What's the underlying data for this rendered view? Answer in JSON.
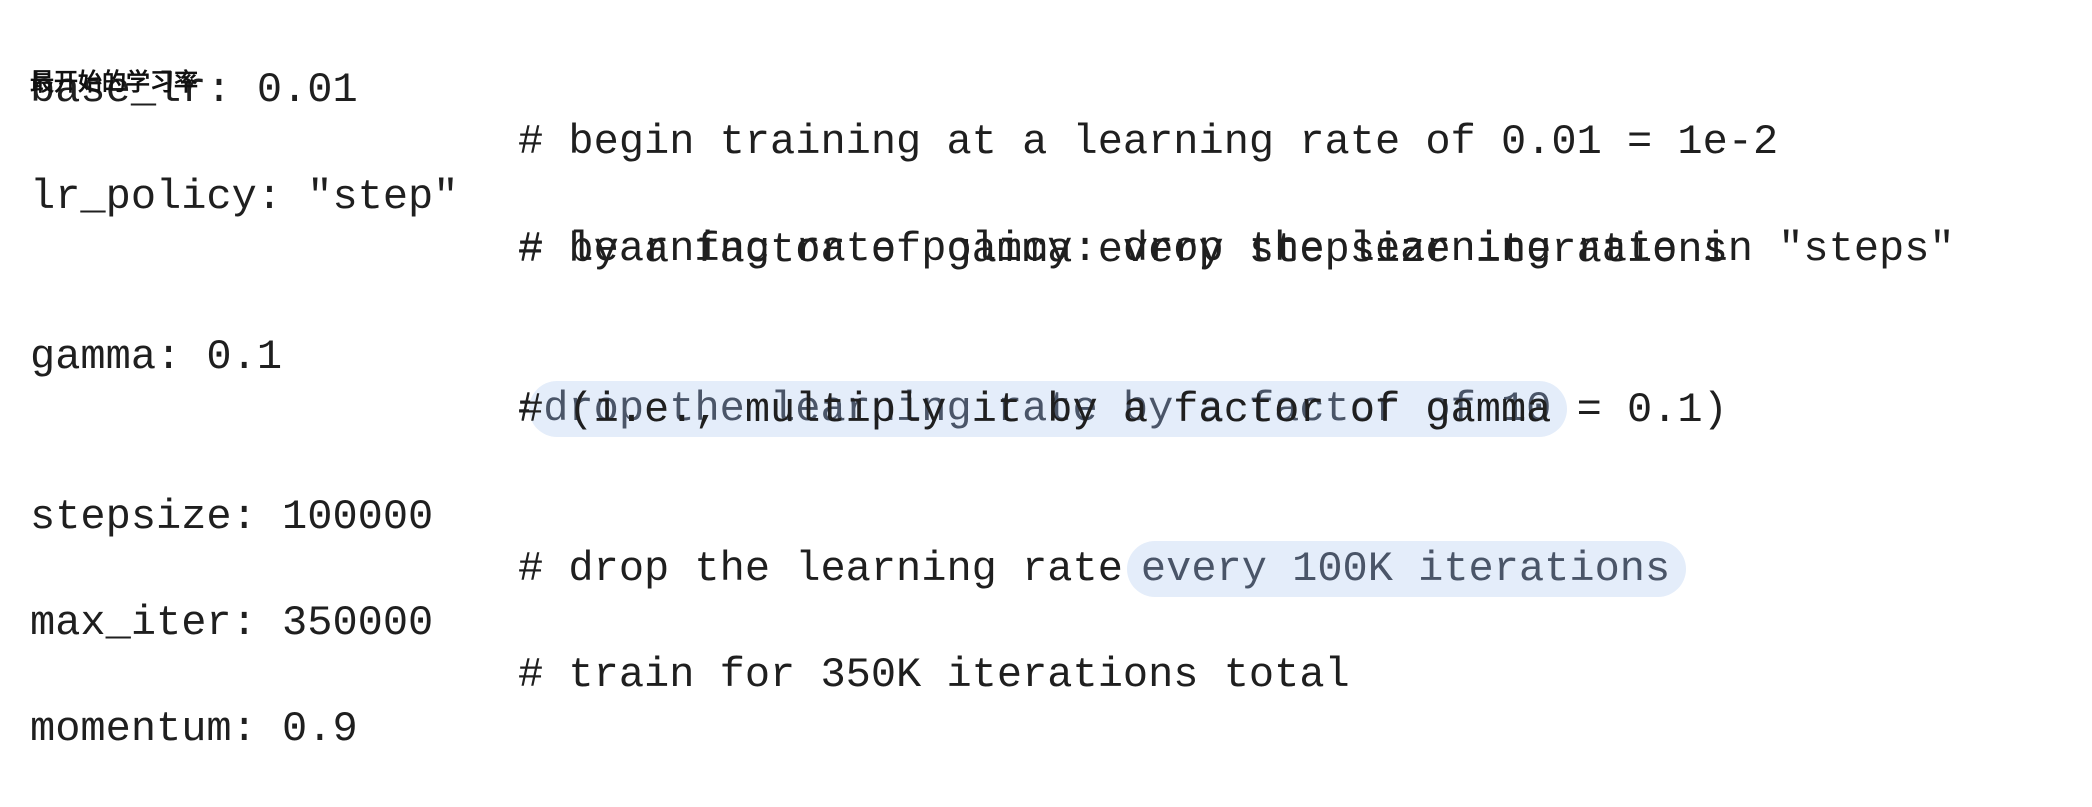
{
  "note": "最开始的学习率",
  "lines": [
    {
      "key": "base_lr: 0.01",
      "comment": "# begin training at a learning rate of 0.01 = 1e-2"
    },
    {
      "key": "lr_policy: \"step\"",
      "comment": "# learning rate policy: drop the learning rate in \"steps\"",
      "comment_cont": "# by a factor of gamma every stepsize iterations"
    },
    {
      "key": "gamma: 0.1",
      "comment_hash": "#",
      "comment_highlight": "drop the learning rate by a factor of 10",
      "comment_cont": "# (i.e., multiply it by a factor of gamma = 0.1)"
    },
    {
      "key": "stepsize: 100000",
      "comment_pre": "# drop the learning rate",
      "comment_highlight": "every 100K iterations"
    },
    {
      "key": "max_iter: 350000",
      "comment": "# train for 350K iterations total"
    },
    {
      "key": "momentum: 0.9"
    }
  ],
  "highlight_color": "#e4edfa"
}
